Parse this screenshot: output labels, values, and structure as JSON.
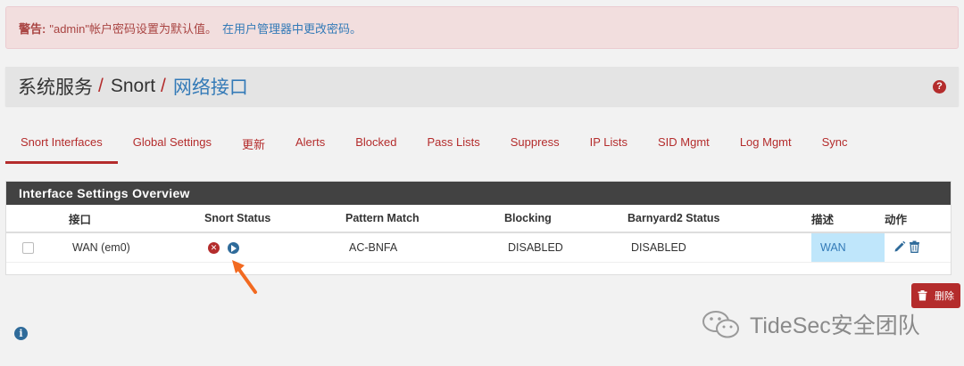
{
  "alert": {
    "label": "警告:",
    "message": "\"admin\"帐户密码设置为默认值。",
    "link": "在用户管理器中更改密码。"
  },
  "breadcrumb": {
    "part1": "系统服务",
    "part2": "Snort",
    "part3": "网络接口",
    "separator": "/",
    "help_icon": "?"
  },
  "tabs": [
    {
      "label": "Snort Interfaces",
      "active": true
    },
    {
      "label": "Global Settings"
    },
    {
      "label": "更新"
    },
    {
      "label": "Alerts"
    },
    {
      "label": "Blocked"
    },
    {
      "label": "Pass Lists"
    },
    {
      "label": "Suppress"
    },
    {
      "label": "IP Lists"
    },
    {
      "label": "SID Mgmt"
    },
    {
      "label": "Log Mgmt"
    },
    {
      "label": "Sync"
    }
  ],
  "panel": {
    "title": "Interface Settings Overview",
    "columns": [
      "接口",
      "Snort Status",
      "Pattern Match",
      "Blocking",
      "Barnyard2 Status",
      "描述",
      "动作"
    ],
    "rows": [
      {
        "interface": "WAN (em0)",
        "pattern_match": "AC-BNFA",
        "blocking": "DISABLED",
        "barnyard2": "DISABLED",
        "description": "WAN"
      }
    ]
  },
  "delete_button": {
    "label": "删除"
  },
  "watermark": {
    "text": "TideSec安全团队"
  },
  "colors": {
    "brand_red": "#b42c2c",
    "link_blue": "#337ab7",
    "panel_header": "#424242",
    "alert_bg": "#f2dede"
  }
}
